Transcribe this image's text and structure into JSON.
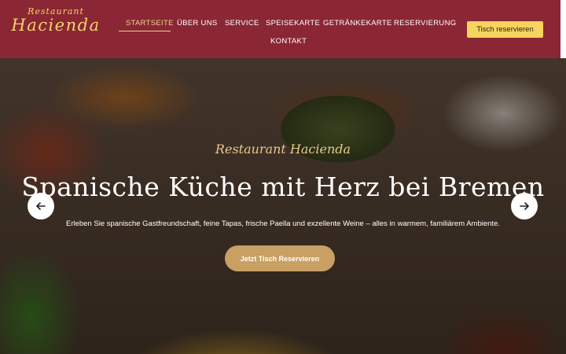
{
  "logo": {
    "top": "Restaurant",
    "main": "Hacienda"
  },
  "nav": {
    "items": [
      {
        "label": "STARTSEITE"
      },
      {
        "label": "ÜBER UNS"
      },
      {
        "label": "SERVICE"
      },
      {
        "label": "SPEISEKARTE"
      },
      {
        "label": "GETRÄNKEKARTE"
      },
      {
        "label": "RESERVIERUNG"
      },
      {
        "label": "KONTAKT"
      }
    ]
  },
  "header_cta": {
    "label": "Tisch reservieren"
  },
  "hero": {
    "subtitle": "Restaurant Hacienda",
    "headline": "Spanische Küche mit Herz bei Bremen",
    "lead": "Erleben Sie spanische Gastfreundschaft, feine Tapas, frische Paella und exzellente Weine – alles in warmem, familiärem Ambiente.",
    "button_label": "Jetzt Tisch Reservieren",
    "prev_icon": "arrow-left-icon",
    "next_icon": "arrow-right-icon"
  },
  "colors": {
    "header": "#8b2635",
    "accent": "#f6d45e",
    "hero_button": "#c9a063"
  }
}
